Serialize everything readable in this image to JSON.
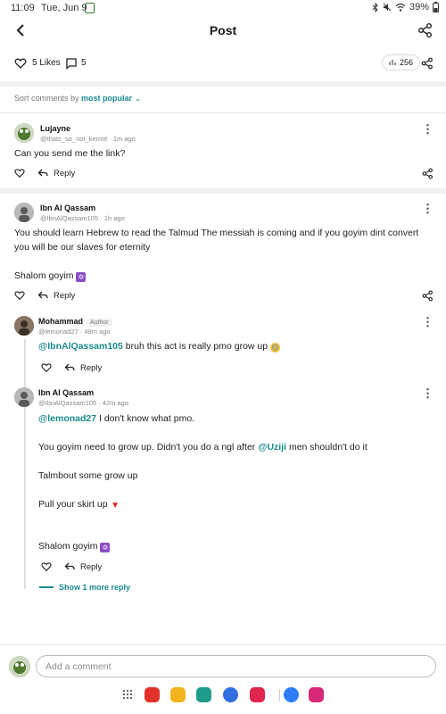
{
  "status_bar": {
    "time": "11:09",
    "date": "Tue, Jun 9",
    "battery": "39%"
  },
  "header": {
    "title": "Post"
  },
  "post_stats": {
    "likes": "5 Likes",
    "comments": "5",
    "views": "256"
  },
  "sort": {
    "prefix": "Sort comments by",
    "mode": "most popular"
  },
  "comments": [
    {
      "name": "Lujayne",
      "handle": "@thats_so_not_kermit",
      "time": "1m ago",
      "text": "Can you send me the link?",
      "reply_label": "Reply"
    },
    {
      "name": "Ibn Al Qassam",
      "handle": "@IbnAlQassam105",
      "time": "1h ago",
      "text_line1": "You should learn Hebrew to read the Talmud The messiah is coming and if you goyim dint convert",
      "text_line2": "you will be our slaves for eternity",
      "text_line3": "Shalom goyim",
      "reply_label": "Reply"
    }
  ],
  "replies": [
    {
      "name": "Mohammad",
      "badge": "Author",
      "handle": "@lemonad27",
      "time": "48m ago",
      "mention": "@IbnAlQassam105",
      "text": " bruh this act is really pmo grow up",
      "reply_label": "Reply"
    },
    {
      "name": "Ibn Al Qassam",
      "handle": "@IbnAlQassam105",
      "time": "42m ago",
      "mention": "@lemonad27",
      "text_line1": " I don't know what pmo.",
      "text_line2a": "You goyim need to grow up. Didn't you do a ngl after ",
      "mention2": "@Uziji",
      "text_line2b": " men shouldn't do it",
      "text_line3": "Talmbout some grow up",
      "text_line4": "Pull your skirt up",
      "text_line5": "Shalom goyim",
      "reply_label": "Reply"
    }
  ],
  "show_more": "Show 1 more reply",
  "composer": {
    "placeholder": "Add a comment"
  },
  "colors": {
    "accent": "#1a8a90",
    "divider": "#f1f1f1"
  }
}
